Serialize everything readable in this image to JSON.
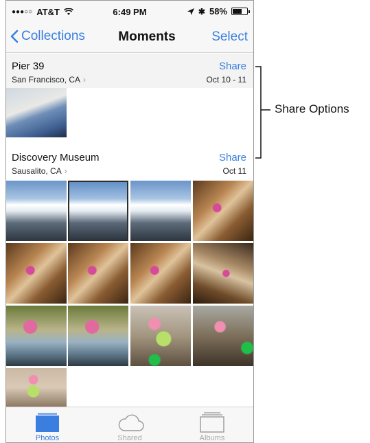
{
  "status": {
    "carrier": "AT&T",
    "time": "6:49 PM",
    "battery": "58%",
    "battery_level": 0.58
  },
  "nav": {
    "back_label": "Collections",
    "title": "Moments",
    "select_label": "Select"
  },
  "sections": [
    {
      "title": "Pier 39",
      "location": "San Francisco, CA",
      "date": "Oct 10 - 11",
      "share_label": "Share"
    },
    {
      "title": "Discovery Museum",
      "location": "Sausalito, CA",
      "date": "Oct 11",
      "share_label": "Share"
    }
  ],
  "tabs": [
    {
      "label": "Photos",
      "active": true
    },
    {
      "label": "Shared",
      "active": false
    },
    {
      "label": "Albums",
      "active": false
    }
  ],
  "annotation": {
    "label": "Share Options"
  },
  "colors": {
    "accent": "#3a7fe0",
    "bar_bg": "#f7f7f7"
  }
}
